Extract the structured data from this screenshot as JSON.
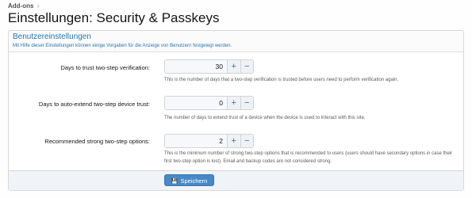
{
  "breadcrumb": {
    "label": "Add-ons"
  },
  "page": {
    "title": "Einstellungen: Security & Passkeys"
  },
  "panel": {
    "title": "Benutzereinstellungen",
    "description": "Mit Hilfe dieser Einstellungen können einige Vorgaben für die Anzeige von Benutzern festgelegt werden."
  },
  "rows": [
    {
      "label": "Days to trust two-step verification:",
      "value": "30",
      "hint": "This is the number of days that a two-step verification is trusted before users need to perform verification again."
    },
    {
      "label": "Days to auto-extend two-step device trust:",
      "value": "0",
      "hint": "The number of days to extend trust of a device when the device is used to interact with this site."
    },
    {
      "label": "Recommended strong two-step options:",
      "value": "2",
      "hint": "This is the minimum number of strong two-step options that is recommended to users (users should have secondary options in case their first two-step option is lost). Email and backup codes are not considered strong."
    }
  ],
  "stepper": {
    "plus": "+",
    "minus": "−"
  },
  "footer": {
    "save_label": "Speichern"
  }
}
